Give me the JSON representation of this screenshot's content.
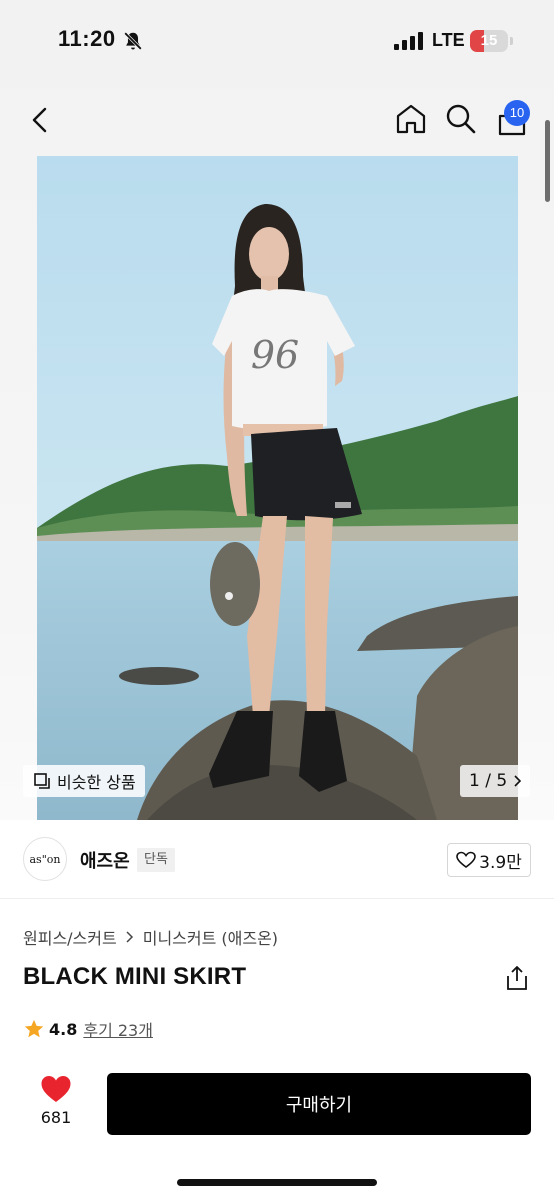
{
  "status_bar": {
    "time": "11:20",
    "network": "LTE",
    "battery": "15",
    "battery_level": 0.15,
    "silent": true
  },
  "nav": {
    "cart_count": "10",
    "icons": [
      "back-icon",
      "home-icon",
      "search-icon",
      "cart-icon"
    ]
  },
  "gallery": {
    "similar_label": "비슷한 상품",
    "pager": "1 / 5",
    "current_image": 1,
    "total_images": 5
  },
  "brand": {
    "logo_text": "as\"on",
    "name": "애즈온",
    "tag": "단독",
    "likes": "3.9만"
  },
  "product": {
    "breadcrumbs": [
      "원피스/스커트",
      "미니스커트 (애즈온)"
    ],
    "title": "BLACK MINI SKIRT",
    "rating": "4.8",
    "reviews": "후기 23개"
  },
  "bottom_bar": {
    "wish_count": "681",
    "buy_label": "구매하기"
  },
  "colors": {
    "accent_blue": "#2864f0",
    "wish_red": "#e8242f",
    "star": "#f5a623",
    "button": "#000000"
  }
}
